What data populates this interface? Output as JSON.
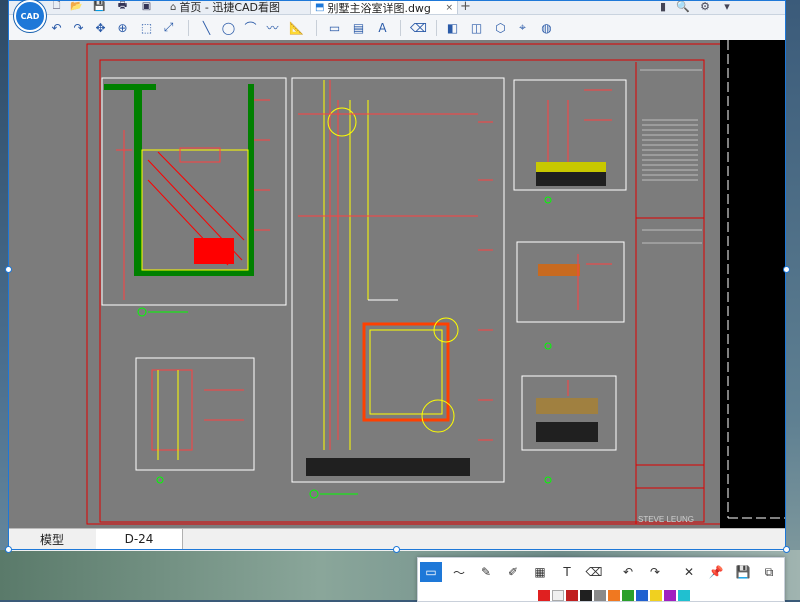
{
  "app": {
    "logo_text": "CAD",
    "tabs": [
      {
        "label": "首页 - 迅捷CAD看图",
        "icon": "home-icon"
      },
      {
        "label": "别墅主浴室详图.dwg",
        "icon": "file-icon",
        "close": "×"
      }
    ],
    "new_tab": "+"
  },
  "quick_tools": [
    {
      "icon": "new-file-icon",
      "glyph": "🗋"
    },
    {
      "icon": "open-folder-icon",
      "glyph": "📂"
    },
    {
      "icon": "save-icon",
      "glyph": "💾"
    },
    {
      "icon": "print-icon",
      "glyph": "🖶"
    },
    {
      "icon": "export-pdf-icon",
      "glyph": "▣"
    }
  ],
  "window_controls": [
    {
      "icon": "pin-icon",
      "glyph": "▮"
    },
    {
      "icon": "search-icon",
      "glyph": "🔍"
    },
    {
      "icon": "settings-icon",
      "glyph": "⚙"
    },
    {
      "icon": "menu-icon",
      "glyph": "▾"
    }
  ],
  "toolbar": [
    {
      "icon": "undo-icon",
      "glyph": "↶"
    },
    {
      "icon": "redo-icon",
      "glyph": "↷"
    },
    {
      "icon": "pan-icon",
      "glyph": "✥"
    },
    {
      "icon": "zoom-in-icon",
      "glyph": "⊕"
    },
    {
      "icon": "zoom-window-icon",
      "glyph": "⬚"
    },
    {
      "icon": "zoom-extents-icon",
      "glyph": "⤢"
    },
    {
      "icon": "line-icon",
      "glyph": "╲"
    },
    {
      "icon": "circle-icon",
      "glyph": "◯"
    },
    {
      "icon": "arc-icon",
      "glyph": "⌒"
    },
    {
      "icon": "polyline-icon",
      "glyph": "〰"
    },
    {
      "icon": "measure-icon",
      "glyph": "📐"
    },
    {
      "icon": "rectangle-icon",
      "glyph": "▭"
    },
    {
      "icon": "layout-icon",
      "glyph": "▤"
    },
    {
      "icon": "text-icon",
      "glyph": "A"
    },
    {
      "icon": "eraser-icon",
      "glyph": "⌫"
    },
    {
      "icon": "layer-icon",
      "glyph": "◧"
    },
    {
      "icon": "block-icon",
      "glyph": "◫"
    },
    {
      "icon": "3d-view-icon",
      "glyph": "⬡"
    },
    {
      "icon": "coordinate-icon",
      "glyph": "⌖"
    },
    {
      "icon": "color-wheel-icon",
      "glyph": "◍"
    }
  ],
  "drawing": {
    "title_block_name": "STEVE LEUNG"
  },
  "bottom_tabs": [
    {
      "label": "模型"
    },
    {
      "label": "D-24"
    }
  ],
  "snip_toolbar": {
    "tools": [
      {
        "icon": "rect-select-icon",
        "glyph": "▭"
      },
      {
        "icon": "freeline-icon",
        "glyph": "〜"
      },
      {
        "icon": "pen-icon",
        "glyph": "✎"
      },
      {
        "icon": "highlighter-icon",
        "glyph": "✐"
      },
      {
        "icon": "mosaic-icon",
        "glyph": "▦"
      },
      {
        "icon": "text-tool-icon",
        "glyph": "T"
      },
      {
        "icon": "eraser-tool-icon",
        "glyph": "⌫"
      },
      {
        "icon": "undo-tool-icon",
        "glyph": "↶"
      },
      {
        "icon": "redo-tool-icon",
        "glyph": "↷"
      },
      {
        "icon": "close-icon",
        "glyph": "✕"
      },
      {
        "icon": "pin-tool-icon",
        "glyph": "📌"
      },
      {
        "icon": "save-tool-icon",
        "glyph": "💾"
      },
      {
        "icon": "copy-icon",
        "glyph": "⧉"
      }
    ],
    "colors": [
      "#e02020",
      "#f0f0f0",
      "#c02020",
      "#202020",
      "#8a8a8a",
      "#f07820",
      "#2aa02a",
      "#2060d0",
      "#f0d020",
      "#a020c0",
      "#20c0d0"
    ]
  },
  "colors": {
    "accent": "#1e78d8",
    "canvas": "#7c7c7c",
    "cad_red": "#e00000",
    "cad_yellow": "#ffff00",
    "cad_green": "#00ff00",
    "cad_white": "#ffffff"
  }
}
